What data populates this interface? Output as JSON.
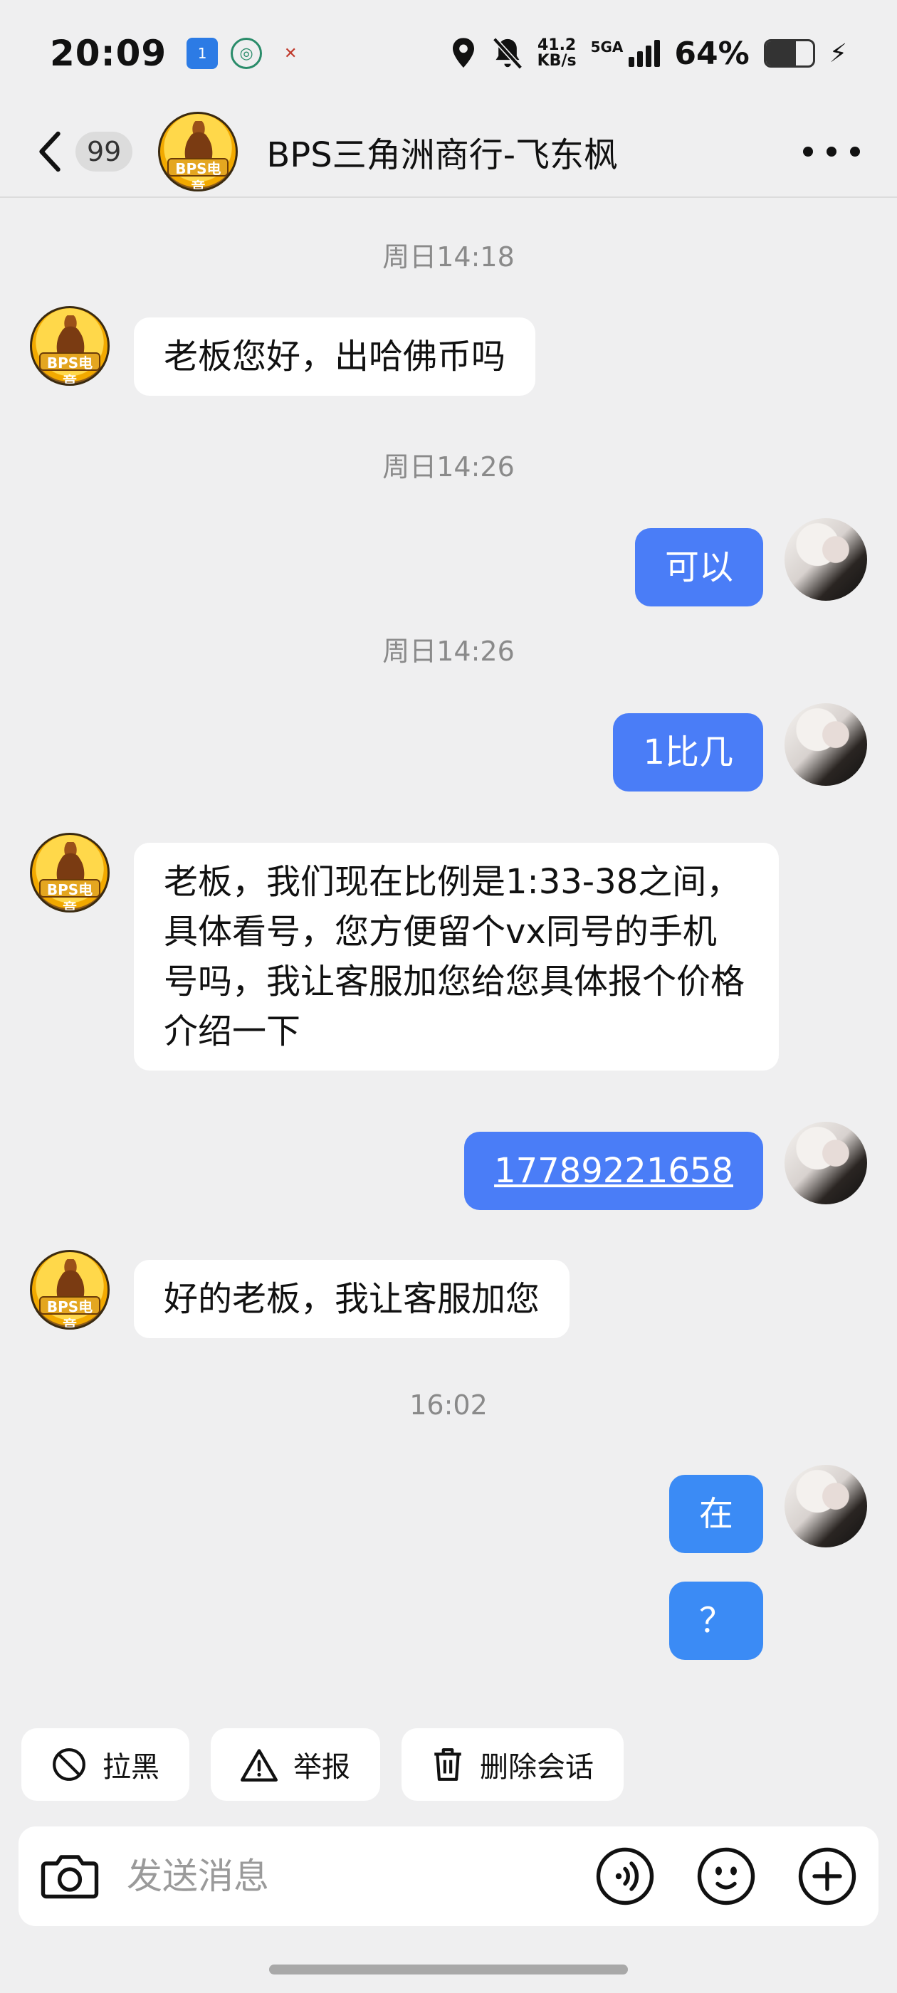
{
  "status_bar": {
    "time": "20:09",
    "notif_1": "1",
    "net_speed_value": "41.2",
    "net_speed_unit": "KB/s",
    "network_type": "5GA",
    "battery_percent": "64%",
    "battery_level": 0.64
  },
  "header": {
    "unread_count": "99",
    "title": "BPS三角洲商行-飞东枫",
    "avatar_tag": "BPS电竞"
  },
  "chat": {
    "timestamps": [
      "周日14:18",
      "周日14:26",
      "周日14:26",
      "16:02"
    ],
    "messages": [
      {
        "from": "merchant",
        "text": "老板您好，出哈佛币吗"
      },
      {
        "from": "me",
        "text": "可以"
      },
      {
        "from": "me",
        "text": "1比几"
      },
      {
        "from": "merchant",
        "text": "老板，我们现在比例是1:33-38之间，具体看号，您方便留个vx同号的手机号吗，我让客服加您给您具体报个价格介绍一下"
      },
      {
        "from": "me",
        "text": "17789221658"
      },
      {
        "from": "merchant",
        "text": "好的老板，我让客服加您"
      },
      {
        "from": "me",
        "text": "在"
      },
      {
        "from": "me",
        "text": "？"
      }
    ]
  },
  "actions": {
    "block": "拉黑",
    "report": "举报",
    "delete": "删除会话"
  },
  "input": {
    "placeholder": "发送消息"
  },
  "colors": {
    "outgoing_bubble": "#4a7df7",
    "outgoing_bubble_bright": "#3b8bf5",
    "background": "#efeff0"
  }
}
